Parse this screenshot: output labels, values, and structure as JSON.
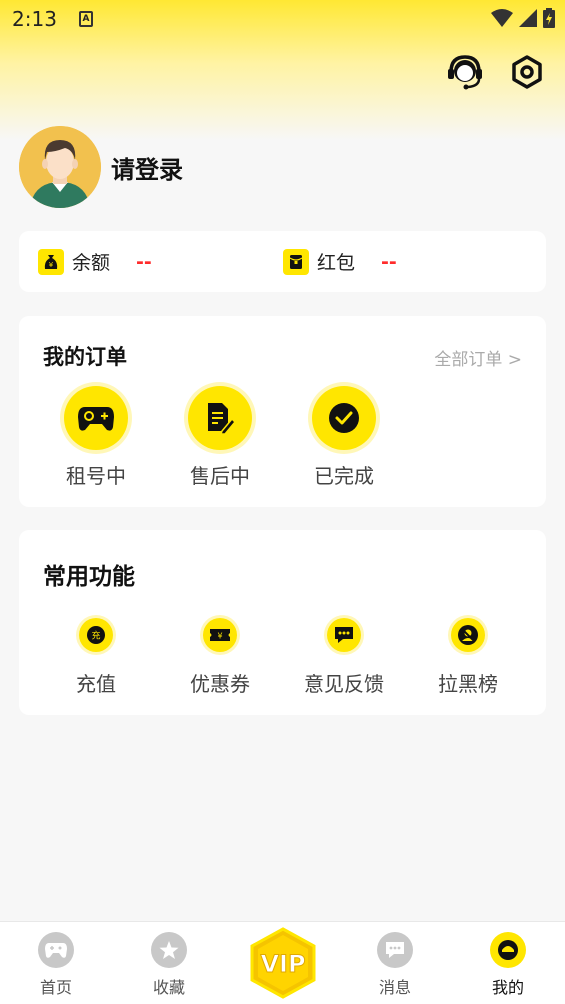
{
  "status_bar": {
    "time": "2:13",
    "notification_letter": "A"
  },
  "profile": {
    "login_text": "请登录"
  },
  "balance": {
    "balance_label": "余额",
    "balance_value": "--",
    "redpacket_label": "红包",
    "redpacket_value": "--"
  },
  "orders": {
    "title": "我的订单",
    "all_link": "全部订单 >",
    "items": [
      {
        "label": "租号中",
        "icon": "gamepad-icon"
      },
      {
        "label": "售后中",
        "icon": "document-edit-icon"
      },
      {
        "label": "已完成",
        "icon": "check-icon"
      }
    ]
  },
  "functions": {
    "title": "常用功能",
    "items": [
      {
        "label": "充值",
        "icon": "recharge-icon",
        "glyph": "充"
      },
      {
        "label": "优惠券",
        "icon": "coupon-icon",
        "glyph": "¥"
      },
      {
        "label": "意见反馈",
        "icon": "feedback-icon"
      },
      {
        "label": "拉黑榜",
        "icon": "blacklist-icon"
      }
    ]
  },
  "tab_bar": {
    "items": [
      {
        "label": "首页",
        "icon": "home-gamepad-icon"
      },
      {
        "label": "收藏",
        "icon": "star-icon"
      },
      {
        "label": "VIP",
        "icon": "vip-icon"
      },
      {
        "label": "消息",
        "icon": "message-icon"
      },
      {
        "label": "我的",
        "icon": "profile-icon",
        "active": true
      }
    ]
  },
  "colors": {
    "accent": "#ffe600",
    "price_red": "#ff2b2b",
    "background": "#f7f7f7"
  }
}
